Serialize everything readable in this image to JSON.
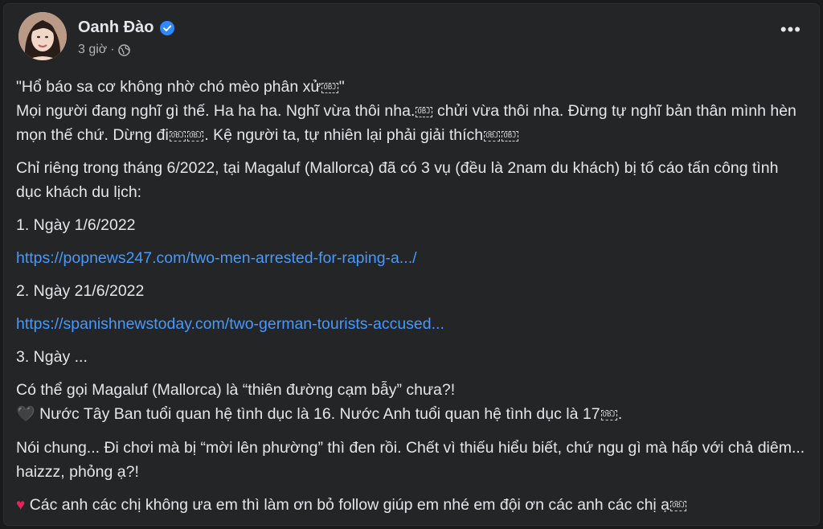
{
  "post": {
    "author": "Oanh Đào",
    "time": "3 giờ",
    "meta_sep": "·",
    "more_label": "•••",
    "icons": {
      "verified": "verified-badge-icon",
      "privacy": "globe-icon",
      "more": "more-options-icon"
    },
    "colors": {
      "link": "#4599ff",
      "verified": "#2d88ff",
      "card": "#242526",
      "text": "#e4e6eb"
    },
    "lines": {
      "quote": "\"Hổ báo sa cơ không nhờ chó mèo phân xử",
      "quote_end": "\"",
      "l2a": "Mọi người đang nghĩ gì thế. Ha ha ha. Nghĩ vừa thôi nha.",
      "l2b": " chửi vừa thôi nha. Đừng tự nghĩ bản thân mình hèn mọn thế chứ. Dừng đi",
      "l2c": ". Kệ người ta, tự nhiên lại phải giải thích",
      "p3": "Chỉ riêng trong tháng 6/2022, tại Magaluf (Mallorca) đã có 3 vụ (đều là 2nam du khách) bị tố cáo tấn công tình dục khách du lịch:",
      "item1": "1. Ngày 1/6/2022",
      "link1": "https://popnews247.com/two-men-arrested-for-raping-a.../",
      "item2": "2. Ngày 21/6/2022",
      "link2": "https://spanishnewstoday.com/two-german-tourists-accused...",
      "item3": "3. Ngày ...",
      "p8a": "Có thể gọi Magaluf (Mallorca) là “thiên đường cạm bẫy” chưa?!",
      "p8b": "Nước Tây Ban tuổi quan hệ tình dục là 16. Nước Anh tuổi quan hệ tình dục là 17",
      "p9": "Nói chung... Đi chơi mà bị “mời lên phường” thì đen rồi. Chết vì thiếu hiểu biết, chứ ngu gì mà hấp với chả diêm... haizzz, phỏng ạ?!",
      "p10": "Các anh các chị không ưa em thì làm ơn bỏ follow giúp em nhé em đội ơn các anh các chị ạ"
    },
    "obj_glyph": "OBJ",
    "hearts": {
      "black": "🖤",
      "red": "♥"
    }
  }
}
